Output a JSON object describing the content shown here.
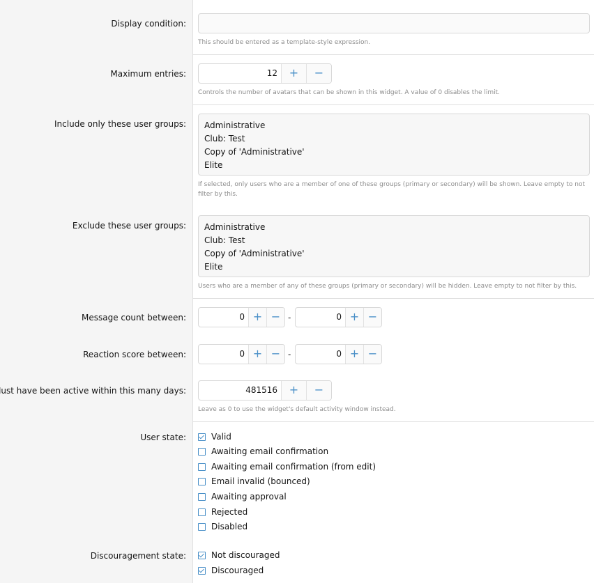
{
  "display_condition": {
    "label": "Display condition:",
    "value": "",
    "hint": "This should be entered as a template-style expression."
  },
  "maximum_entries": {
    "label": "Maximum entries:",
    "value": "12",
    "hint": "Controls the number of avatars that can be shown in this widget. A value of 0 disables the limit."
  },
  "include_groups": {
    "label": "Include only these user groups:",
    "options": [
      "Administrative",
      "Club: Test",
      "Copy of 'Administrative'",
      "Elite"
    ],
    "hint": "If selected, only users who are a member of one of these groups (primary or secondary) will be shown. Leave empty to not filter by this."
  },
  "exclude_groups": {
    "label": "Exclude these user groups:",
    "options": [
      "Administrative",
      "Club: Test",
      "Copy of 'Administrative'",
      "Elite"
    ],
    "hint": "Users who are a member of any of these groups (primary or secondary) will be hidden. Leave empty to not filter by this."
  },
  "message_count": {
    "label": "Message count between:",
    "min": "0",
    "max": "0",
    "separator": "-"
  },
  "reaction_score": {
    "label": "Reaction score between:",
    "min": "0",
    "max": "0",
    "separator": "-"
  },
  "active_days": {
    "label": "Must have been active within this many days:",
    "value": "481516",
    "hint": "Leave as 0 to use the widget's default activity window instead."
  },
  "user_state": {
    "label": "User state:",
    "options": [
      {
        "label": "Valid",
        "checked": true
      },
      {
        "label": "Awaiting email confirmation",
        "checked": false
      },
      {
        "label": "Awaiting email confirmation (from edit)",
        "checked": false
      },
      {
        "label": "Email invalid (bounced)",
        "checked": false
      },
      {
        "label": "Awaiting approval",
        "checked": false
      },
      {
        "label": "Rejected",
        "checked": false
      },
      {
        "label": "Disabled",
        "checked": false
      }
    ]
  },
  "discouragement_state": {
    "label": "Discouragement state:",
    "options": [
      {
        "label": "Not discouraged",
        "checked": true
      },
      {
        "label": "Discouraged",
        "checked": true
      }
    ]
  },
  "stepper": {
    "plus": "+",
    "minus": "−"
  }
}
